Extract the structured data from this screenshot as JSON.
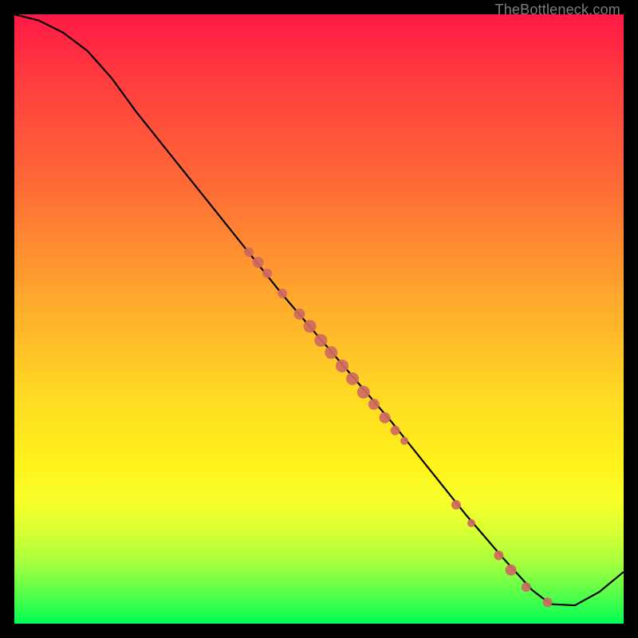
{
  "attribution": "TheBottleneck.com",
  "colors": {
    "marker": "#cf6a61",
    "curve": "#000000",
    "bg_top": "#ff1846",
    "bg_bottom": "#00ff55",
    "frame": "#000000"
  },
  "chart_data": {
    "type": "line",
    "title": "",
    "xlabel": "",
    "ylabel": "",
    "xlim": [
      0,
      100
    ],
    "ylim": [
      0,
      100
    ],
    "note": "No numeric axes are displayed; x/y are relative (0–100) positions within the plot area. y = 100 is the top, y = 0 is the bottom. The curve descends from top-left, reaches a minimum plateau near x≈86–93 at y≈3, then rises toward the right edge.",
    "series": [
      {
        "name": "curve",
        "x": [
          0,
          4,
          8,
          12,
          16,
          20,
          26,
          32,
          38,
          44,
          50,
          56,
          62,
          68,
          74,
          80,
          85,
          88,
          92,
          96,
          100
        ],
        "y": [
          100,
          99,
          97,
          94,
          89.5,
          84,
          76.5,
          69,
          61.5,
          54,
          47,
          40,
          33,
          25.5,
          18,
          11,
          5.5,
          3.2,
          3.0,
          5.2,
          8.5
        ]
      }
    ],
    "markers": {
      "name": "highlighted-points",
      "note": "Salmon-colored dots sitting on the curve; sizes vary slightly.",
      "points": [
        {
          "x": 38.5,
          "y": 61.0,
          "r": 6
        },
        {
          "x": 40.0,
          "y": 59.3,
          "r": 7
        },
        {
          "x": 41.5,
          "y": 57.5,
          "r": 6
        },
        {
          "x": 44.0,
          "y": 54.2,
          "r": 6
        },
        {
          "x": 46.8,
          "y": 50.8,
          "r": 7
        },
        {
          "x": 48.5,
          "y": 48.8,
          "r": 8
        },
        {
          "x": 50.3,
          "y": 46.5,
          "r": 8
        },
        {
          "x": 52.0,
          "y": 44.5,
          "r": 8
        },
        {
          "x": 53.8,
          "y": 42.3,
          "r": 8
        },
        {
          "x": 55.5,
          "y": 40.2,
          "r": 8
        },
        {
          "x": 57.3,
          "y": 38.0,
          "r": 8
        },
        {
          "x": 59.0,
          "y": 36.0,
          "r": 7
        },
        {
          "x": 60.8,
          "y": 33.8,
          "r": 7
        },
        {
          "x": 62.5,
          "y": 31.7,
          "r": 6
        },
        {
          "x": 64.0,
          "y": 30.0,
          "r": 5
        },
        {
          "x": 72.5,
          "y": 19.5,
          "r": 6
        },
        {
          "x": 75.0,
          "y": 16.5,
          "r": 5
        },
        {
          "x": 79.5,
          "y": 11.2,
          "r": 6
        },
        {
          "x": 81.5,
          "y": 8.8,
          "r": 7
        },
        {
          "x": 84.0,
          "y": 6.0,
          "r": 6
        },
        {
          "x": 87.5,
          "y": 3.5,
          "r": 6
        }
      ]
    }
  }
}
